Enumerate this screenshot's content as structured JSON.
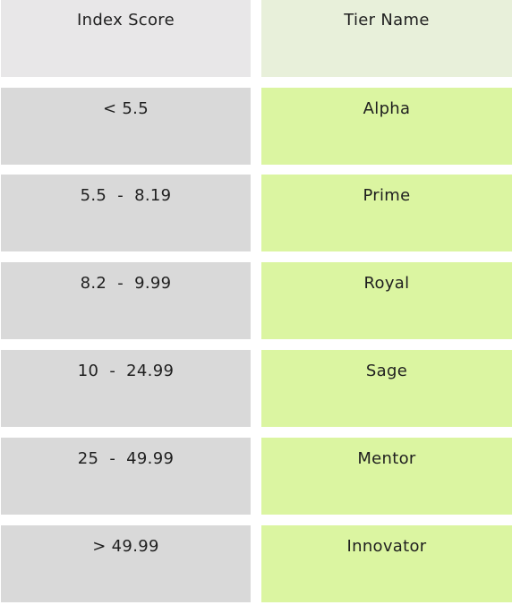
{
  "table": {
    "headers": {
      "score": "Index Score",
      "tier": "Tier Name"
    },
    "rows": [
      {
        "score": "< 5.5",
        "tier": "Alpha"
      },
      {
        "score": "5.5  -  8.19",
        "tier": "Prime"
      },
      {
        "score": "8.2  -  9.99",
        "tier": "Royal"
      },
      {
        "score": "10  -  24.99",
        "tier": "Sage"
      },
      {
        "score": "25  -  49.99",
        "tier": "Mentor"
      },
      {
        "score": "> 49.99",
        "tier": "Innovator"
      }
    ]
  },
  "colors": {
    "header_left_bg": "#e8e7e8",
    "header_right_bg": "#e8f0da",
    "row_left_bg": "#d9d9d9",
    "row_right_bg": "#dbf5a1"
  }
}
